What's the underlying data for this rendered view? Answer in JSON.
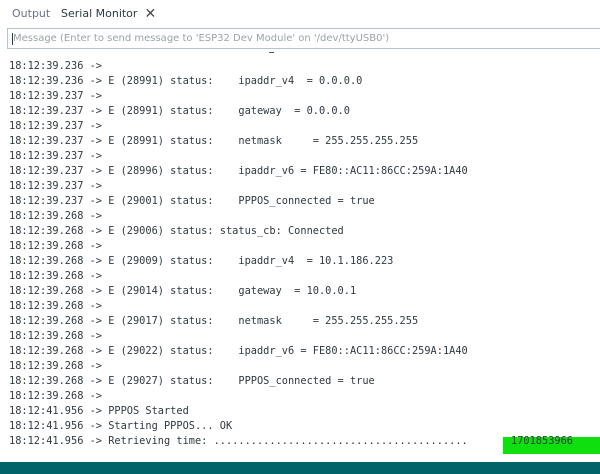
{
  "tabs": {
    "output_label": "Output",
    "serial_label": "Serial Monitor",
    "close_glyph": "✕"
  },
  "message": {
    "placeholder": "Message (Enter to send message to 'ESP32 Dev Module' on '/dev/ttyUSB0')"
  },
  "log_lines": [
    "18:12:39.236 ->",
    "18:12:39.236 -> E (28991) status:    ipaddr_v4  = 0.0.0.0",
    "18:12:39.237 ->",
    "18:12:39.237 -> E (28991) status:    gateway  = 0.0.0.0",
    "18:12:39.237 ->",
    "18:12:39.237 -> E (28991) status:    netmask     = 255.255.255.255",
    "18:12:39.237 ->",
    "18:12:39.237 -> E (28996) status:    ipaddr_v6 = FE80::AC11:86CC:259A:1A40",
    "18:12:39.237 ->",
    "18:12:39.237 -> E (29001) status:    PPPOS_connected = true",
    "18:12:39.268 ->",
    "18:12:39.268 -> E (29006) status: status_cb: Connected",
    "18:12:39.268 ->",
    "18:12:39.268 -> E (29009) status:    ipaddr_v4  = 10.1.186.223",
    "18:12:39.268 ->",
    "18:12:39.268 -> E (29014) status:    gateway  = 10.0.0.1",
    "18:12:39.268 ->",
    "18:12:39.268 -> E (29017) status:    netmask     = 255.255.255.255",
    "18:12:39.268 ->",
    "18:12:39.268 -> E (29022) status:    ipaddr_v6 = FE80::AC11:86CC:259A:1A40",
    "18:12:39.268 ->",
    "18:12:39.268 -> E (29027) status:    PPPOS_connected = true",
    "18:12:39.268 ->",
    "18:12:41.956 -> PPPOS Started",
    "18:12:41.956 -> Starting PPPOS... OK",
    "18:12:41.956 -> Retrieving time: .........................................",
    "1701853966"
  ],
  "colors": {
    "highlight": "#0fde0f",
    "statusbar": "#006468"
  }
}
